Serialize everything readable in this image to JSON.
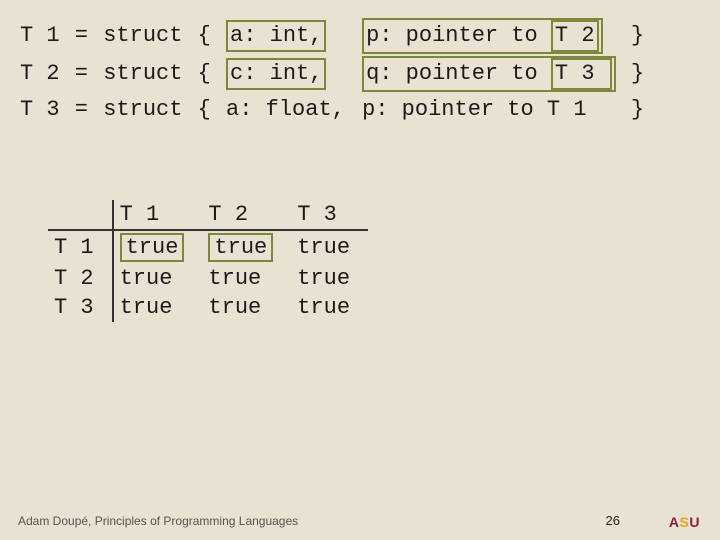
{
  "defs": [
    {
      "lhs": "T 1",
      "eq": " = ",
      "kw": "struct",
      "open": " { ",
      "field1_boxed": true,
      "field1": "a: int,",
      "mid": " ",
      "field2_boxed": true,
      "field2pre": "p: pointer to ",
      "ref_boxed": true,
      "ref": "T 2",
      "close": " }"
    },
    {
      "lhs": "T 2",
      "eq": " = ",
      "kw": "struct",
      "open": " { ",
      "field1_boxed": true,
      "field1": "c: int,",
      "mid": " ",
      "field2_boxed": true,
      "field2pre": "q: pointer to ",
      "ref_boxed": true,
      "ref": "T 3 ",
      "close": " }"
    },
    {
      "lhs": "T 3",
      "eq": " = ",
      "kw": "struct",
      "open": " { ",
      "field1_boxed": false,
      "field1": "a: float,",
      "mid": " ",
      "field2_boxed": false,
      "field2pre": "p: pointer to T 1",
      "ref_boxed": false,
      "ref": "",
      "close": " }"
    }
  ],
  "matrix": {
    "cols": [
      "T 1",
      "T 2",
      "T 3"
    ],
    "rows": [
      "T 1",
      "T 2",
      "T 3"
    ],
    "cells": [
      [
        {
          "v": "true",
          "box": true
        },
        {
          "v": "true",
          "box": true
        },
        {
          "v": "true",
          "box": false
        }
      ],
      [
        {
          "v": "true",
          "box": false
        },
        {
          "v": "true",
          "box": false
        },
        {
          "v": "true",
          "box": false
        }
      ],
      [
        {
          "v": "true",
          "box": false
        },
        {
          "v": "true",
          "box": false
        },
        {
          "v": "true",
          "box": false
        }
      ]
    ]
  },
  "footer": "Adam Doupé, Principles of Programming Languages",
  "page": "26",
  "logo": {
    "a": "A",
    "s": "S",
    "u": "U"
  }
}
